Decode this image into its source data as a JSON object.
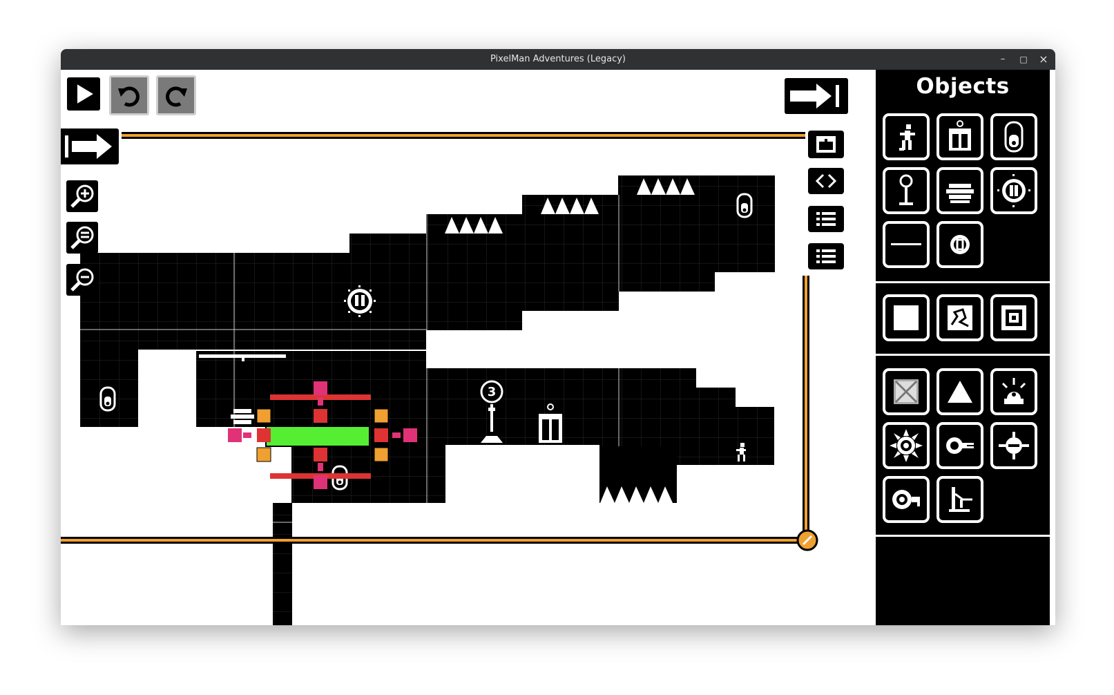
{
  "window": {
    "title": "PixelMan Adventures (Legacy)"
  },
  "window_controls": {
    "minimize": "–",
    "maximize": "□",
    "close": "×"
  },
  "toolbar": {
    "play": "play",
    "undo": "undo",
    "redo": "redo",
    "undo_enabled": false,
    "redo_enabled": false
  },
  "sidebar": {
    "title": "Objects",
    "groups": [
      [
        "player-icon",
        "door-icon",
        "switch-icon",
        "checkpoint-icon",
        "cannon-icon",
        "teleporter-icon",
        "platform-icon",
        "coin-icon"
      ],
      [
        "solid-block-icon",
        "breakable-block-icon",
        "frame-block-icon"
      ],
      [
        "crate-icon",
        "spike-icon",
        "alarm-turret-icon",
        "saw-blade-icon",
        "laser-turret-icon",
        "drone-icon",
        "key-turret-icon",
        "piston-icon"
      ]
    ]
  },
  "level": {
    "checkpoint_number": "3"
  },
  "colors": {
    "border_orange": "#f0a030",
    "selection_green": "#55ee33",
    "handle_red": "#dd3333",
    "handle_pink": "#e03377",
    "handle_orange": "#f0a030"
  }
}
